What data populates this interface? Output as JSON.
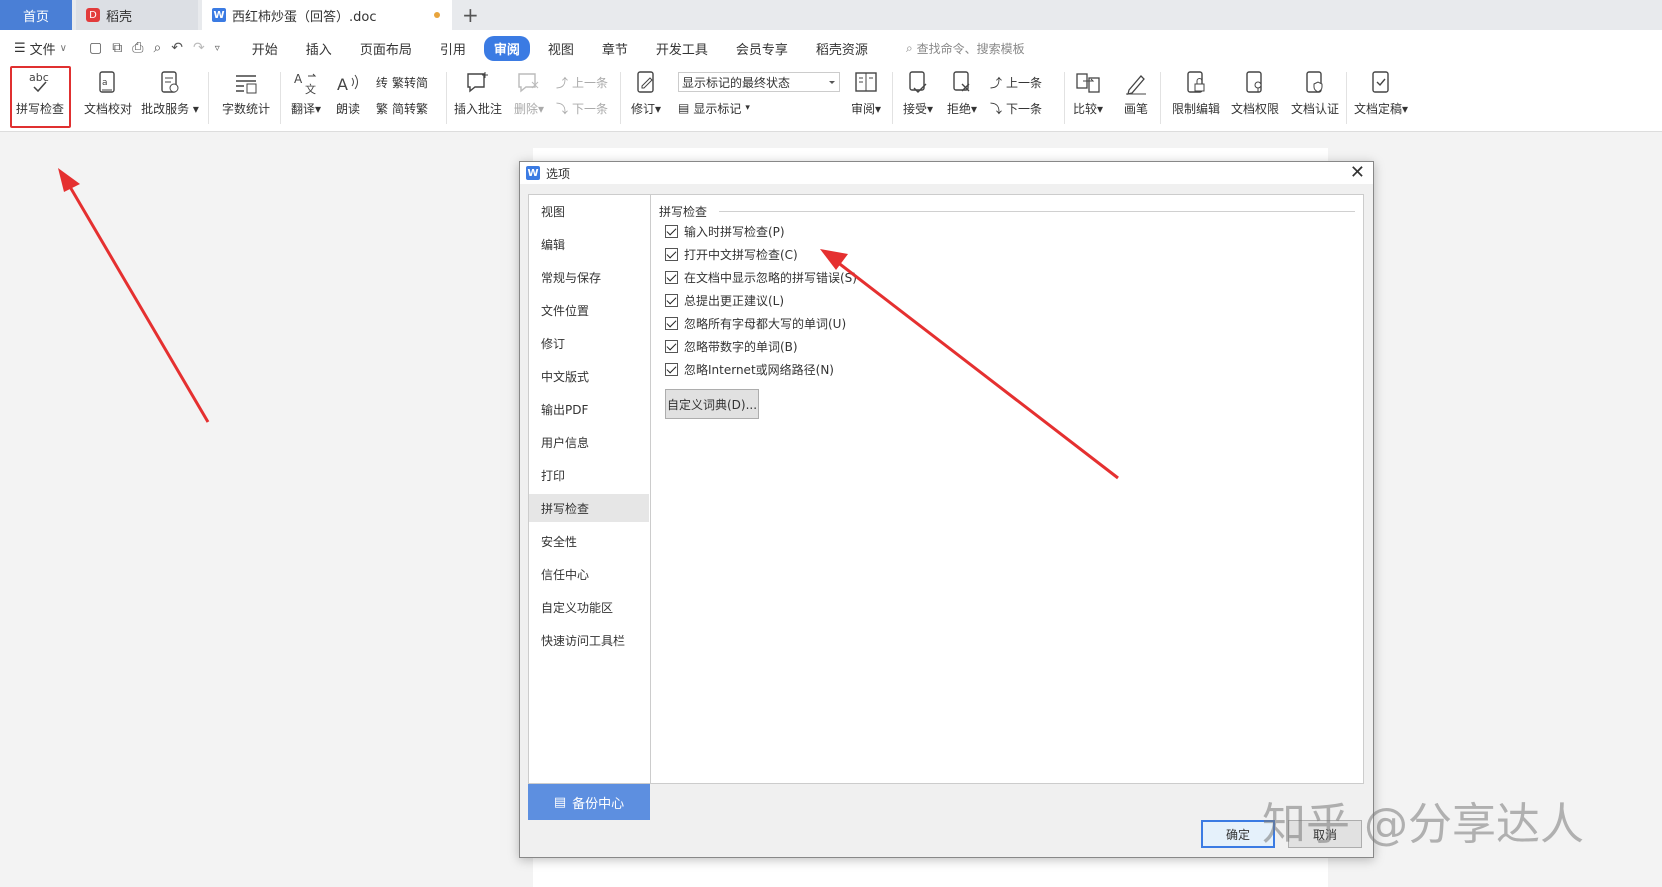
{
  "tabs": {
    "home": "首页",
    "daoke": "稻壳",
    "document": "西红柿炒蛋（回答）.doc",
    "add": "+"
  },
  "menu": {
    "file": "文件",
    "items": [
      "开始",
      "插入",
      "页面布局",
      "引用",
      "审阅",
      "视图",
      "章节",
      "开发工具",
      "会员专享",
      "稻壳资源"
    ],
    "active": "审阅",
    "search_placeholder": "查找命令、搜索模板"
  },
  "ribbon": {
    "spell_check": "拼写检查",
    "doc_proof": "文档校对",
    "review_service": "批改服务",
    "word_count": "字数统计",
    "translate": "翻译",
    "read_aloud": "朗读",
    "trad_to_simp": "繁转简",
    "simp_to_trad": "简转繁",
    "insert_comment": "插入批注",
    "delete": "删除",
    "prev_comment": "上一条",
    "next_comment": "下一条",
    "track_changes": "修订",
    "markup_combo": "显示标记的最终状态",
    "show_markup": "显示标记",
    "review": "审阅",
    "accept": "接受",
    "reject": "拒绝",
    "prev_change": "上一条",
    "next_change": "下一条",
    "compare": "比较",
    "ink": "画笔",
    "restrict_edit": "限制编辑",
    "doc_permission": "文档权限",
    "doc_certify": "文档认证",
    "finalize": "文档定稿"
  },
  "dialog": {
    "title": "选项",
    "nav": [
      "视图",
      "编辑",
      "常规与保存",
      "文件位置",
      "修订",
      "中文版式",
      "输出PDF",
      "用户信息",
      "打印",
      "拼写检查",
      "安全性",
      "信任中心",
      "自定义功能区",
      "快速访问工具栏"
    ],
    "selected_nav": "拼写检查",
    "backup": "备份中心",
    "group_title": "拼写检查",
    "options": [
      {
        "label": "输入时拼写检查(P)",
        "checked": true
      },
      {
        "label": "打开中文拼写检查(C)",
        "checked": true
      },
      {
        "label": "在文档中显示忽略的拼写错误(S)",
        "checked": true
      },
      {
        "label": "总提出更正建议(L)",
        "checked": true
      },
      {
        "label": "忽略所有字母都大写的单词(U)",
        "checked": true
      },
      {
        "label": "忽略带数字的单词(B)",
        "checked": true
      },
      {
        "label": "忽略Internet或网络路径(N)",
        "checked": true
      }
    ],
    "custom_dict": "自定义词典(D)...",
    "ok": "确定",
    "cancel": "取消"
  },
  "watermark": "知乎 @分享达人",
  "colors": {
    "accent": "#3b7be3",
    "arrow": "#e53030",
    "backup_bg": "#5d8fe0"
  }
}
